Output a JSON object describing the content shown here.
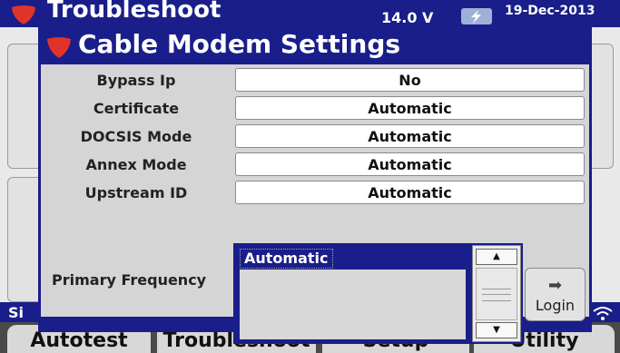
{
  "background": {
    "title": "Troubleshoot",
    "voltage": "14.0 V",
    "date": "19-Dec-2013",
    "status_text": "Si",
    "nav": [
      "Autotest",
      "Troubleshoot",
      "Setup",
      "Utility"
    ]
  },
  "dialog": {
    "title": "Cable Modem Settings",
    "fields": [
      {
        "label": "Bypass Ip",
        "value": "No"
      },
      {
        "label": "Certificate",
        "value": "Automatic"
      },
      {
        "label": "DOCSIS Mode",
        "value": "Automatic"
      },
      {
        "label": "Annex Mode",
        "value": "Automatic"
      },
      {
        "label": "Upstream ID",
        "value": "Automatic"
      }
    ],
    "primary_frequency": {
      "label": "Primary Frequency",
      "selected": "Automatic"
    },
    "login_label": "Login"
  },
  "icons": {
    "logo": "shield-logo-icon",
    "battery": "battery-charging-icon",
    "wifi": "wifi-icon",
    "scroll_up": "triangle-up-icon",
    "scroll_down": "triangle-down-icon",
    "login_arrow": "arrow-right-icon"
  },
  "colors": {
    "header_blue": "#1a1e8a",
    "logo_red": "#e0342a",
    "panel_gray": "#d5d5d5"
  }
}
